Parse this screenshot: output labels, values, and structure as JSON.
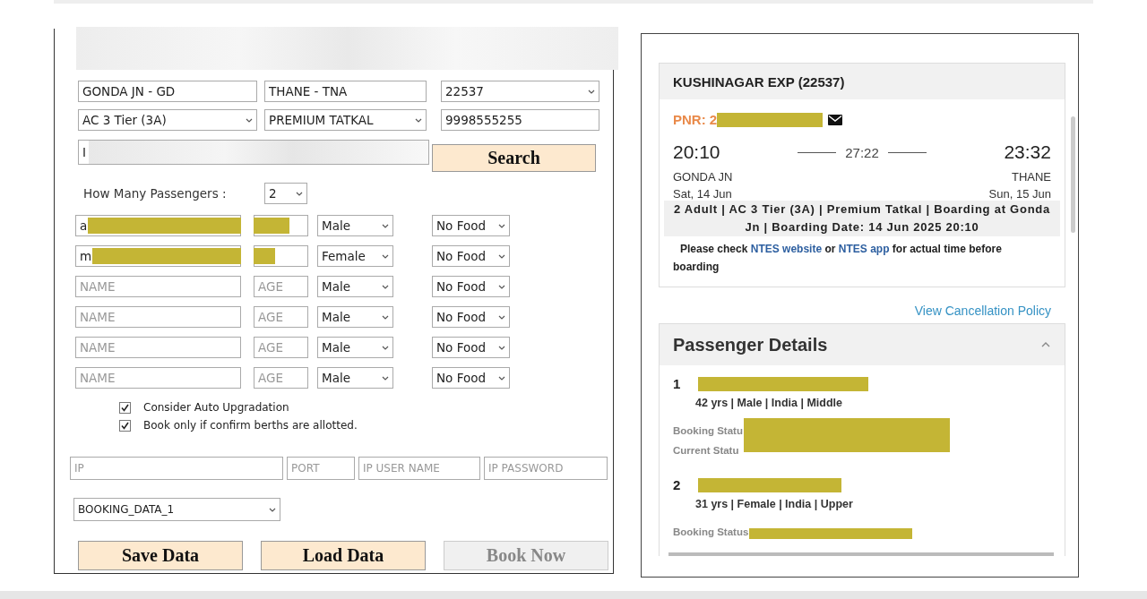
{
  "booking_form": {
    "route": {
      "from": "GONDA JN - GD",
      "to": "THANE - TNA",
      "train": "22537"
    },
    "class_row": {
      "class": "AC 3 Tier (3A)",
      "quota": "PREMIUM TATKAL",
      "mobile": "9998555255"
    },
    "third_row": {
      "value": "I",
      "blurred": true
    },
    "search_button": "Search",
    "passenger_count": {
      "label": "How Many Passengers  :",
      "value": "2"
    },
    "passengers": [
      {
        "name": "a",
        "redacted": true,
        "gender": "Male",
        "food": "No Food"
      },
      {
        "name": "m",
        "redacted": true,
        "gender": "Female",
        "food": "No Food"
      },
      {
        "name_placeholder": "NAME",
        "redacted": false,
        "age_placeholder": "AGE",
        "gender": "Male",
        "food": "No Food"
      },
      {
        "name_placeholder": "NAME",
        "redacted": false,
        "age_placeholder": "AGE",
        "gender": "Male",
        "food": "No Food"
      },
      {
        "name_placeholder": "NAME",
        "redacted": false,
        "age_placeholder": "AGE",
        "gender": "Male",
        "food": "No Food"
      },
      {
        "name_placeholder": "NAME",
        "redacted": false,
        "age_placeholder": "AGE",
        "gender": "Male",
        "food": "No Food"
      }
    ],
    "options": [
      {
        "label": "Consider Auto Upgradation",
        "checked": true
      },
      {
        "label": "Book only if confirm berths are allotted.",
        "checked": true
      }
    ],
    "proxy": [
      {
        "placeholder": "IP"
      },
      {
        "placeholder": "PORT"
      },
      {
        "placeholder": "IP USER NAME"
      },
      {
        "placeholder": "IP PASSWORD"
      }
    ],
    "profile": "BOOKING_DATA_1",
    "buttons": [
      {
        "label": "Save Data",
        "disabled": false
      },
      {
        "label": "Load Data",
        "disabled": false
      },
      {
        "label": "Book Now",
        "disabled": true
      }
    ]
  },
  "ticket": {
    "train_title": "KUSHINAGAR EXP (22537)",
    "pnr": "PNR: 2",
    "departure": {
      "time": "20:10",
      "station": "GONDA JN",
      "date": "Sat, 14 Jun"
    },
    "duration": "27:22",
    "arrival": {
      "time": "23:32",
      "station": "THANE",
      "date": "Sun, 15 Jun"
    },
    "summary": "2 Adult | AC 3 Tier (3A) | Premium Tatkal | Boarding at Gonda Jn | Boarding Date: 14 Jun 2025 20:10",
    "notice": {
      "before": "Please check",
      "link_1": "NTES website",
      "middle": "or",
      "link_2": "NTES app",
      "after": "for actual time before boarding"
    },
    "cancellation_link": "View Cancellation Policy",
    "passenger_details": {
      "title": "Passenger Details",
      "expanded": true,
      "passengers": [
        {
          "number": "1",
          "info": "42 yrs | Male | India | Middle",
          "status_labels": [
            "Booking Statu",
            "Current Statu"
          ]
        },
        {
          "number": "2",
          "info": "31 yrs | Female | India | Upper",
          "status_labels": [
            "Booking Status"
          ]
        }
      ]
    }
  }
}
